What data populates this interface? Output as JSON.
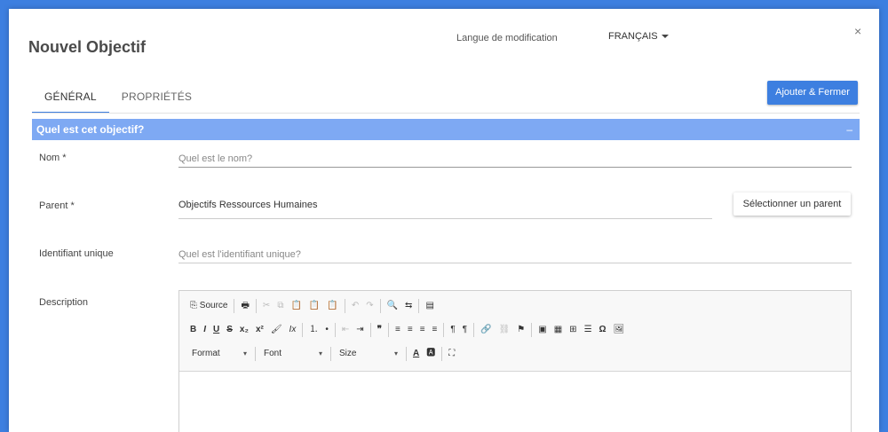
{
  "header": {
    "title": "Nouvel Objectif",
    "language_label": "Langue de modification",
    "language_value": "FRANÇAIS",
    "close_glyph": "×"
  },
  "tabs": [
    {
      "label": "GÉNÉRAL",
      "active": true
    },
    {
      "label": "PROPRIÉTÉS",
      "active": false
    }
  ],
  "actions": {
    "add_close": "Ajouter & Fermer",
    "select_parent": "Sélectionner un parent"
  },
  "section": {
    "title": "Quel est cet objectif?",
    "collapse_glyph": "–"
  },
  "form": {
    "name_label": "Nom *",
    "name_placeholder": "Quel est le nom?",
    "parent_label": "Parent *",
    "parent_value": "Objectifs Ressources Humaines",
    "uid_label": "Identifiant unique",
    "uid_placeholder": "Quel est l'identifiant unique?",
    "description_label": "Description"
  },
  "editor": {
    "row1": [
      "⎘ Source",
      "🖶",
      "✂",
      "⧉",
      "📋",
      "📋",
      "📋",
      "↶",
      "↷",
      "🔍",
      "⇆",
      "▤"
    ],
    "row2": [
      "B",
      "I",
      "U",
      "S",
      "x₂",
      "x²",
      "🖌",
      "Ix",
      "⒈",
      "•",
      "⇤",
      "⇥",
      "❞",
      "≡",
      "≡",
      "≡",
      "≡",
      "¶",
      "¶",
      "🔗",
      "⛓",
      "⚑",
      "▣",
      "▦",
      "⊞",
      "☰",
      "Ω",
      "🖼"
    ],
    "format": "Format",
    "font": "Font",
    "size": "Size",
    "row3_icons": [
      "A",
      "🅰",
      "⛶"
    ]
  },
  "colors": {
    "accent": "#3d7fe0",
    "section": "#7ea9f3"
  }
}
